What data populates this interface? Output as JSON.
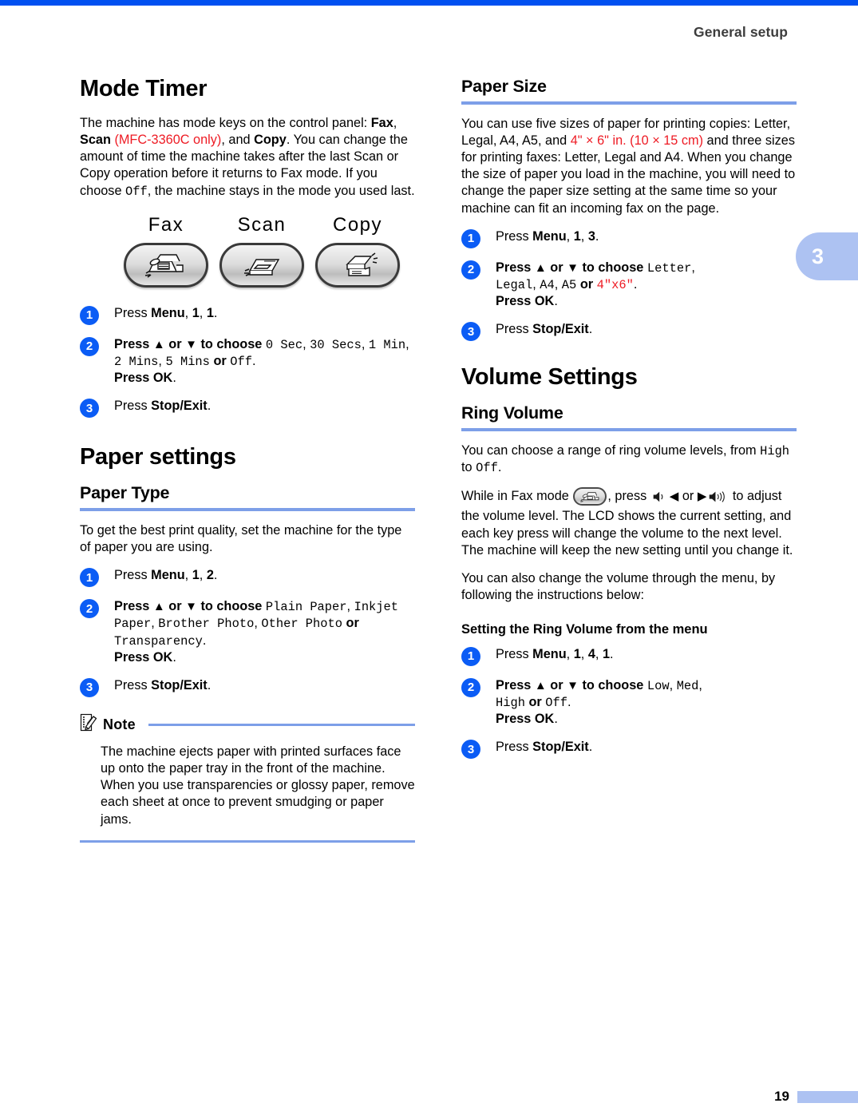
{
  "header": {
    "title": "General setup"
  },
  "chapter_tab": {
    "number": "3"
  },
  "footer": {
    "page_number": "19"
  },
  "left_column": {
    "section_title": "Mode Timer",
    "intro": {
      "t1": "The machine has mode keys on the control panel: ",
      "fax": "Fax",
      "c1": ", ",
      "scan": "Scan",
      "note_red": " (MFC-3360C only)",
      "c2": ", and ",
      "copy": "Copy",
      "t2": ". You can change the amount of time the machine takes after the last Scan or Copy operation before it returns to Fax mode. If you choose ",
      "off": "Off",
      "t3": ", the machine stays in the mode you used last."
    },
    "mode_keys": [
      {
        "label": "Fax",
        "icon": "fax-machine-icon"
      },
      {
        "label": "Scan",
        "icon": "scanner-icon"
      },
      {
        "label": "Copy",
        "icon": "copier-icon"
      }
    ],
    "mode_timer_steps": [
      {
        "n": "1",
        "text": "Press Menu, 1, 1."
      },
      {
        "n": "2",
        "text": "Press ▲ or ▼ to choose 0 Sec, 30 Secs, 1 Min, 2 Mins, 5 Mins or Off. Press OK."
      },
      {
        "n": "3",
        "text": "Press Stop/Exit."
      }
    ],
    "paper_settings_title": "Paper settings",
    "paper_type_title": "Paper Type",
    "paper_type_intro": "To get the best print quality, set the machine for the type of paper you are using.",
    "paper_type_steps": [
      {
        "n": "1",
        "text": "Press Menu, 1, 2."
      },
      {
        "n": "2",
        "text": "Press ▲ or ▼ to choose Plain Paper, Inkjet Paper, Brother Photo, Other Photo or Transparency. Press OK."
      },
      {
        "n": "3",
        "text": "Press Stop/Exit."
      }
    ],
    "note": {
      "label": "Note",
      "icon": "note-pencil-icon",
      "body": "The machine ejects paper with printed surfaces face up onto the paper tray in the front of the machine. When you use transparencies or glossy paper, remove each sheet at once to prevent smudging or paper jams."
    },
    "step_labels": {
      "press": "Press ",
      "menu": "Menu",
      "ok": "OK",
      "stop_exit": "Stop/Exit",
      "or": " or ",
      "to_choose": " to choose ",
      "up_arrow": "▲",
      "down_arrow": "▼",
      "press_ok": "Press ",
      "period": "."
    },
    "mode_timer_options": [
      "0 Sec",
      "30 Secs",
      "1 Min",
      "2 Mins",
      "5 Mins",
      "Off"
    ],
    "paper_type_options": [
      "Plain Paper",
      "Inkjet Paper",
      "Brother Photo",
      "Other Photo",
      "Transparency"
    ],
    "menu_codes": {
      "mode_timer": [
        "1",
        "1"
      ],
      "paper_type": [
        "1",
        "2"
      ]
    }
  },
  "right_column": {
    "paper_size_title": "Paper Size",
    "paper_size_intro": {
      "t1": "You can use five sizes of paper for printing copies: Letter, Legal, A4, A5, and ",
      "red1": "4\" × 6\" in. (10 × 15 cm)",
      "t2": " and three sizes for printing faxes: Letter, Legal and A4. When you change the size of paper you load in the machine, you will need to change the paper size setting at the same time so your machine can fit an incoming fax on the page."
    },
    "paper_size_steps": [
      {
        "n": "1",
        "text": "Press Menu, 1, 3."
      },
      {
        "n": "2",
        "text": "Press ▲ or ▼ to choose Letter, Legal, A4, A5 or 4\"x6\". Press OK."
      },
      {
        "n": "3",
        "text": "Press Stop/Exit."
      }
    ],
    "paper_size_options": [
      "Letter",
      "Legal",
      "A4",
      "A5",
      "4\"x6\""
    ],
    "volume_settings_title": "Volume Settings",
    "ring_volume_title": "Ring Volume",
    "ring_volume_intro": {
      "t1": "You can choose a range of ring volume levels, from ",
      "high": "High",
      "t2": " to ",
      "off": "Off",
      "t3": "."
    },
    "ring_volume_p2": {
      "t1": "While in Fax mode ",
      "t2": ", press ",
      "or": " or ",
      "t3": " to adjust the volume level. The LCD shows the current setting, and each key press will change the volume to the next level. The machine will keep the new setting until you change it.",
      "left_arrow": "◀",
      "right_arrow": "▶",
      "icon_fax": "fax-machine-icon",
      "icon_vol_low": "speaker-low-icon",
      "icon_vol_high": "speaker-high-icon"
    },
    "ring_volume_p3": "You can also change the volume through the menu, by following the instructions below:",
    "ring_menu_title": "Setting the Ring Volume from the menu",
    "ring_menu_steps": [
      {
        "n": "1",
        "text": "Press Menu, 1, 4, 1."
      },
      {
        "n": "2",
        "text": "Press ▲ or ▼ to choose Low, Med, High or Off. Press OK."
      },
      {
        "n": "3",
        "text": "Press Stop/Exit."
      }
    ],
    "ring_volume_options": [
      "Low",
      "Med",
      "High",
      "Off"
    ],
    "menu_codes": {
      "paper_size": [
        "1",
        "3"
      ],
      "ring_volume": [
        "1",
        "4",
        "1"
      ]
    }
  },
  "colors": {
    "top_bar": "#0050f0",
    "rule": "#7d9fe8",
    "tab": "#adc2f2",
    "badge": "#0b5cf5",
    "red_text": "#ee1b24"
  }
}
